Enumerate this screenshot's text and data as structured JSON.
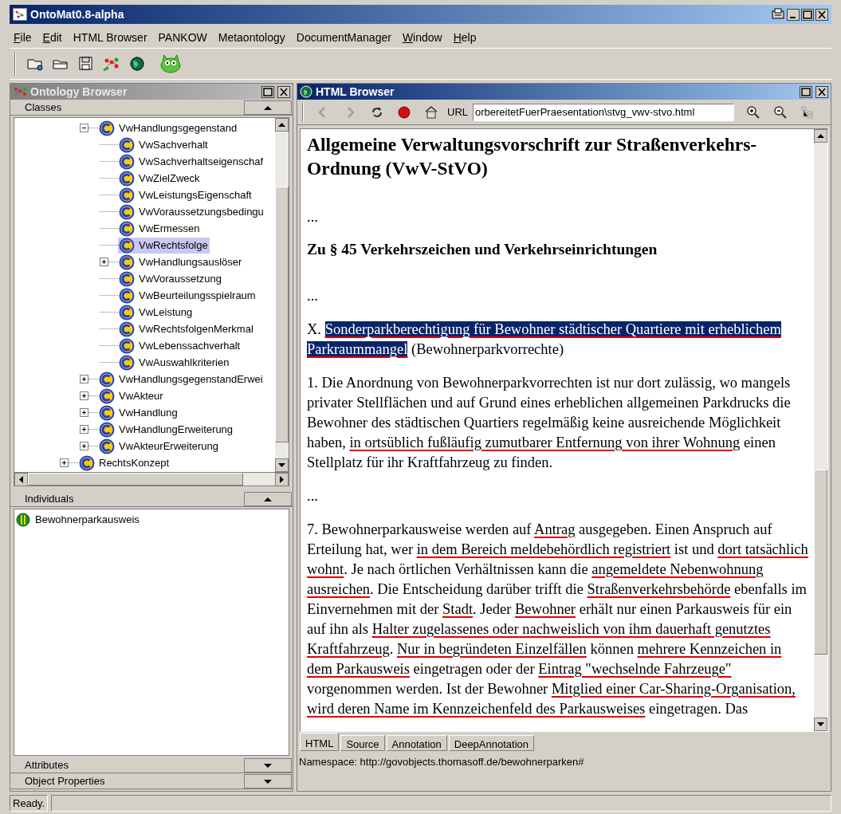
{
  "window": {
    "title": "OntoMat0.8-alpha"
  },
  "menu": [
    {
      "label": "File",
      "mnemonic": true
    },
    {
      "label": "Edit",
      "mnemonic": true
    },
    {
      "label": "HTML Browser",
      "mnemonic": false
    },
    {
      "label": "PANKOW",
      "mnemonic": false
    },
    {
      "label": "Metaontology",
      "mnemonic": false
    },
    {
      "label": "DocumentManager",
      "mnemonic": false
    },
    {
      "label": "Window",
      "mnemonic": true
    },
    {
      "label": "Help",
      "mnemonic": true
    }
  ],
  "toolbar": [
    {
      "kind": "open"
    },
    {
      "kind": "folder"
    },
    {
      "kind": "save"
    },
    {
      "kind": "ontology"
    },
    {
      "kind": "globe"
    },
    {
      "kind": "creature"
    }
  ],
  "ontology_browser": {
    "title": "Ontology Browser",
    "active": false,
    "classes": {
      "label": "Classes",
      "expanded": true
    },
    "tree": {
      "items": [
        {
          "children": [
            {
              "label": "VwHandlungsgegenstand",
              "expanded": true,
              "selected": false,
              "children": [
                {
                  "label": "VwSachverhalt",
                  "selected": false
                },
                {
                  "label": "VwSachverhaltseigenschaf",
                  "selected": false
                },
                {
                  "label": "VwZielZweck",
                  "selected": false
                },
                {
                  "label": "VwLeistungsEigenschaft",
                  "selected": false
                },
                {
                  "label": "VwVoraussetzungsbedingu",
                  "selected": false
                },
                {
                  "label": "VwErmessen",
                  "selected": false
                },
                {
                  "label": "VwRechtsfolge",
                  "selected": true
                },
                {
                  "label": "VwHandlungsauslöser",
                  "expanded": false,
                  "selected": false
                },
                {
                  "label": "VwVoraussetzung",
                  "selected": false
                },
                {
                  "label": "VwBeurteilungsspielraum",
                  "selected": false
                },
                {
                  "label": "VwLeistung",
                  "selected": false
                },
                {
                  "label": "VwRechtsfolgenMerkmal",
                  "selected": false
                },
                {
                  "label": "VwLebenssachverhalt",
                  "selected": false
                },
                {
                  "label": "VwAuswahlkriterien",
                  "selected": false
                }
              ]
            },
            {
              "label": "VwHandlungsgegenstandErwei",
              "expanded": false,
              "selected": false
            },
            {
              "label": "VwAkteur",
              "expanded": false,
              "selected": false
            },
            {
              "label": "VwHandlung",
              "expanded": false,
              "selected": false
            },
            {
              "label": "VwHandlungErweiterung",
              "expanded": false,
              "selected": false
            },
            {
              "label": "VwAkteurErweiterung",
              "expanded": false,
              "selected": false
            }
          ]
        },
        {
          "label": "RechtsKonzept",
          "expanded": false,
          "selected": false
        }
      ]
    },
    "individuals": {
      "label": "Individuals",
      "expanded": true,
      "items": [
        "Bewohnerparkausweis"
      ]
    },
    "sections": [
      {
        "label": "Attributes",
        "expanded": false
      },
      {
        "label": "Object Properties",
        "expanded": false
      }
    ]
  },
  "html_browser": {
    "title": "HTML Browser",
    "active": true,
    "toolbar": [
      {
        "kind": "back",
        "disabled": true
      },
      {
        "kind": "forward",
        "disabled": true
      },
      {
        "kind": "refresh",
        "disabled": false
      },
      {
        "kind": "stop",
        "disabled": false
      },
      {
        "kind": "home",
        "disabled": false
      }
    ],
    "url_label": "URL",
    "url": "orbereitetFuerPraesentation\\stvg_vwv-stvo.html",
    "tools": [
      {
        "kind": "zoom-in",
        "disabled": false
      },
      {
        "kind": "zoom-out",
        "disabled": false
      },
      {
        "kind": "tree",
        "disabled": true
      }
    ],
    "document": [
      {
        "kind": "title",
        "text": "Allgemeine Verwaltungsvorschrift zur Straßenverkehrs-Ordnung (VwV-StVO)"
      },
      {
        "kind": "para",
        "segments": [
          {
            "text": "...",
            "annotated": false,
            "selected": false
          }
        ]
      },
      {
        "kind": "subheading",
        "text": "Zu § 45 Verkehrszeichen und Verkehrseinrichtungen"
      },
      {
        "kind": "para",
        "segments": [
          {
            "text": "...",
            "annotated": false,
            "selected": false
          }
        ]
      },
      {
        "kind": "para",
        "segments": [
          {
            "text": "X. ",
            "annotated": false,
            "selected": false
          },
          {
            "text": "Sonderparkberechtigung für Bewohner städtischer Quartiere mit erheblichem Parkraummangel",
            "annotated": true,
            "selected": true
          },
          {
            "text": " (Bewohnerparkvorrechte)",
            "annotated": false,
            "selected": false
          }
        ]
      },
      {
        "kind": "para",
        "segments": [
          {
            "text": "1. Die Anordnung von Bewohnerparkvorrechten ist nur dort zulässig, wo mangels privater Stellflächen und auf Grund eines erheblichen allgemeinen Parkdrucks die Bewohner des städtischen Quartiers regelmäßig keine ausreichende Möglichkeit haben, ",
            "annotated": false,
            "selected": false
          },
          {
            "text": "in ortsüblich fußläufig zumutbarer Entfernung von ihrer Wohnung",
            "annotated": true,
            "selected": false
          },
          {
            "text": " einen Stellplatz für ihr Kraftfahrzeug zu finden.",
            "annotated": false,
            "selected": false
          }
        ]
      },
      {
        "kind": "para",
        "segments": [
          {
            "text": "...",
            "annotated": false,
            "selected": false
          }
        ]
      },
      {
        "kind": "para",
        "segments": [
          {
            "text": "7. Bewohnerparkausweise werden auf ",
            "annotated": false,
            "selected": false
          },
          {
            "text": "Antrag",
            "annotated": true,
            "selected": false
          },
          {
            "text": " ausgegeben. Einen Anspruch auf Erteilung hat, wer ",
            "annotated": false,
            "selected": false
          },
          {
            "text": "in dem Bereich meldebehördlich registriert",
            "annotated": true,
            "selected": false
          },
          {
            "text": " ist und ",
            "annotated": false,
            "selected": false
          },
          {
            "text": "dort tatsächlich wohnt",
            "annotated": true,
            "selected": false
          },
          {
            "text": ". Je nach örtlichen Verhältnissen kann die ",
            "annotated": false,
            "selected": false
          },
          {
            "text": "angemeldete Nebenwohnung ausreichen",
            "annotated": true,
            "selected": false
          },
          {
            "text": ". Die Entscheidung darüber trifft die ",
            "annotated": false,
            "selected": false
          },
          {
            "text": "Straßenverkehrsbehörde",
            "annotated": true,
            "selected": false
          },
          {
            "text": " ebenfalls im Einvernehmen mit der ",
            "annotated": false,
            "selected": false
          },
          {
            "text": "Stadt",
            "annotated": true,
            "selected": false
          },
          {
            "text": ". Jeder ",
            "annotated": false,
            "selected": false
          },
          {
            "text": "Bewohner",
            "annotated": true,
            "selected": false
          },
          {
            "text": " erhält nur einen Parkausweis für ein auf ihn als ",
            "annotated": false,
            "selected": false
          },
          {
            "text": "Halter zugelassenes oder nachweislich von ihm dauerhaft genutztes Kraftfahrzeug",
            "annotated": true,
            "selected": false
          },
          {
            "text": ". ",
            "annotated": false,
            "selected": false
          },
          {
            "text": "Nur in begründeten Einzelfällen",
            "annotated": true,
            "selected": false
          },
          {
            "text": " können ",
            "annotated": false,
            "selected": false
          },
          {
            "text": "mehrere Kennzeichen in dem Parkausweis",
            "annotated": true,
            "selected": false
          },
          {
            "text": " eingetragen oder der ",
            "annotated": false,
            "selected": false
          },
          {
            "text": "Eintrag \"wechselnde Fahrzeuge\"",
            "annotated": true,
            "selected": false
          },
          {
            "text": " vorgenommen werden. Ist der Bewohner ",
            "annotated": false,
            "selected": false
          },
          {
            "text": "Mitglied einer Car-Sharing-Organisation, wird deren Name im Kennzeichenfeld des Parkausweises",
            "annotated": true,
            "selected": false
          },
          {
            "text": " eingetragen. Das",
            "annotated": false,
            "selected": false
          }
        ]
      }
    ],
    "tabs": [
      {
        "label": "HTML",
        "selected": true
      },
      {
        "label": "Source",
        "selected": false
      },
      {
        "label": "Annotation",
        "selected": false
      },
      {
        "label": "DeepAnnotation",
        "selected": false
      }
    ],
    "namespace": "Namespace: http://govobjects.thomasoff.de/bewohnerparken#"
  },
  "status_bar": {
    "text": "Ready."
  }
}
